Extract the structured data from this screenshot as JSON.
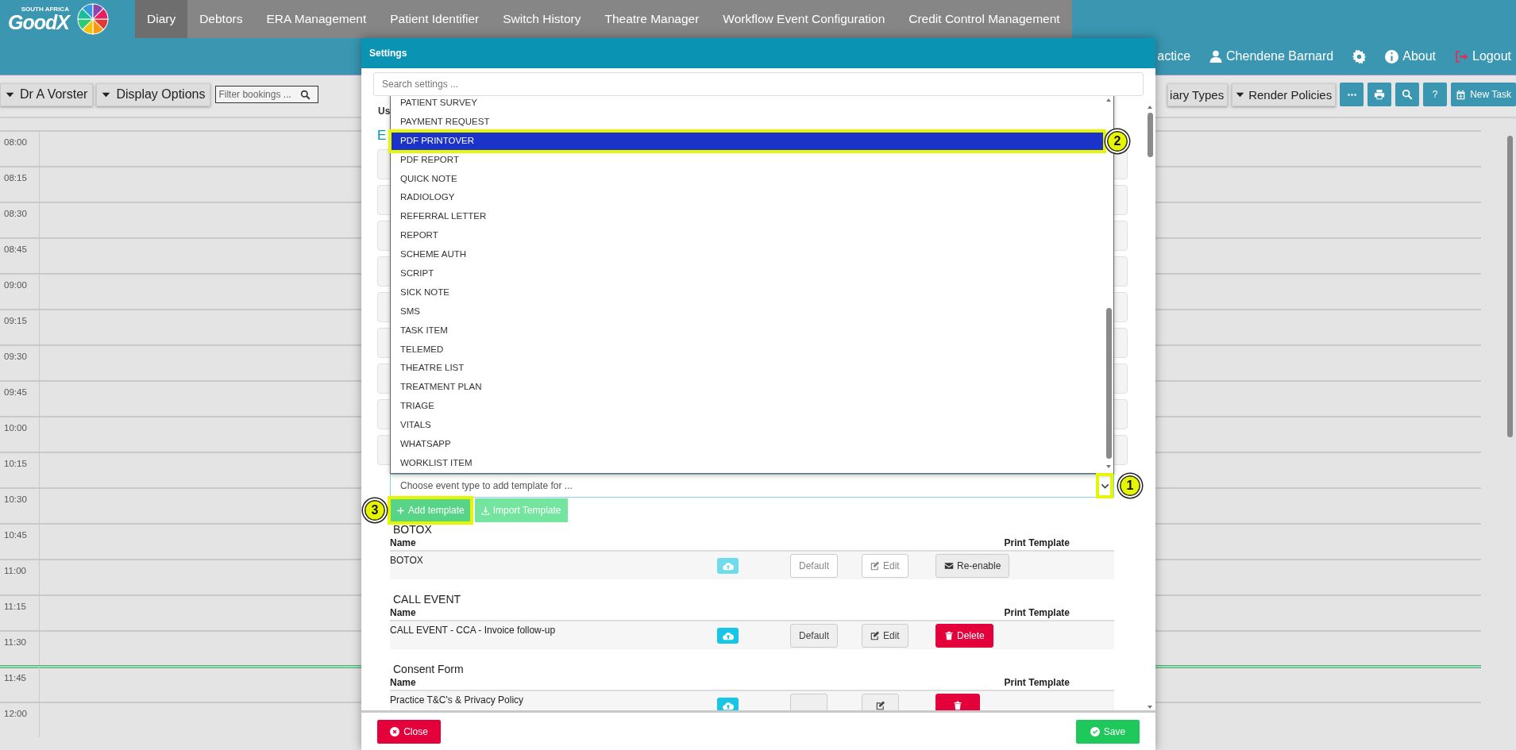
{
  "nav": {
    "logo": {
      "tagline": "SOUTH AFRICA",
      "wordmark": "GoodX"
    },
    "items": [
      {
        "label": "Diary",
        "selected": true
      },
      {
        "label": "Debtors",
        "selected": false
      },
      {
        "label": "ERA Management",
        "selected": false
      },
      {
        "label": "Patient Identifier",
        "selected": false
      },
      {
        "label": "Switch History",
        "selected": false
      },
      {
        "label": "Theatre Manager",
        "selected": false
      },
      {
        "label": "Workflow Event Configuration",
        "selected": false
      },
      {
        "label": "Credit Control Management",
        "selected": false
      }
    ]
  },
  "header": {
    "practice": "actice",
    "user": "Chendene Barnard",
    "about": "About",
    "logout": "Logout"
  },
  "toolbar": {
    "dropdowns_left": [
      "Dr A Vorster",
      "Display Options"
    ],
    "filter": {
      "placeholder": "Filter bookings ..."
    },
    "dropdowns_right": [
      {
        "label": "iary Types",
        "caret": false
      },
      {
        "label": "Render Policies",
        "caret": true
      }
    ],
    "help": "?",
    "new_task": "New Task"
  },
  "diary": {
    "slots": [
      {
        "time": "08:00",
        "now": false
      },
      {
        "time": "08:15",
        "now": false
      },
      {
        "time": "08:30",
        "now": false
      },
      {
        "time": "08:45",
        "now": false
      },
      {
        "time": "09:00",
        "now": false
      },
      {
        "time": "09:15",
        "now": false
      },
      {
        "time": "09:30",
        "now": false
      },
      {
        "time": "09:45",
        "now": false
      },
      {
        "time": "10:00",
        "now": false
      },
      {
        "time": "10:15",
        "now": false
      },
      {
        "time": "10:30",
        "now": false
      },
      {
        "time": "10:45",
        "now": false
      },
      {
        "time": "11:00",
        "now": false
      },
      {
        "time": "11:15",
        "now": false
      },
      {
        "time": "11:30",
        "now": true
      },
      {
        "time": "11:45",
        "now": false
      },
      {
        "time": "12:00",
        "now": false
      }
    ]
  },
  "settings": {
    "title": "Settings",
    "search": {
      "placeholder": "Search settings ..."
    },
    "behind": {
      "column_label": "Us",
      "heading": "E"
    },
    "event_type": {
      "placeholder": "Choose event type to add template for ...",
      "options": [
        {
          "label": "PATIENT SURVEY",
          "selected": false
        },
        {
          "label": "PAYMENT REQUEST",
          "selected": false
        },
        {
          "label": "PDF PRINTOVER",
          "selected": true
        },
        {
          "label": "PDF REPORT",
          "selected": false
        },
        {
          "label": "QUICK NOTE",
          "selected": false
        },
        {
          "label": "RADIOLOGY",
          "selected": false
        },
        {
          "label": "REFERRAL LETTER",
          "selected": false
        },
        {
          "label": "REPORT",
          "selected": false
        },
        {
          "label": "SCHEME AUTH",
          "selected": false
        },
        {
          "label": "SCRIPT",
          "selected": false
        },
        {
          "label": "SICK NOTE",
          "selected": false
        },
        {
          "label": "SMS",
          "selected": false
        },
        {
          "label": "TASK ITEM",
          "selected": false
        },
        {
          "label": "TELEMED",
          "selected": false
        },
        {
          "label": "THEATRE LIST",
          "selected": false
        },
        {
          "label": "TREATMENT PLAN",
          "selected": false
        },
        {
          "label": "TRIAGE",
          "selected": false
        },
        {
          "label": "VITALS",
          "selected": false
        },
        {
          "label": "WHATSAPP",
          "selected": false
        },
        {
          "label": "WORKLIST ITEM",
          "selected": false
        }
      ]
    },
    "actions": [
      {
        "label": "Add template",
        "kind": "add"
      },
      {
        "label": "Import Template",
        "kind": "import"
      }
    ],
    "sections": [
      {
        "title": "BOTOX",
        "columns": [
          "Name",
          "Print Template"
        ],
        "rows": [
          {
            "name": "BOTOX",
            "disabled": true,
            "buttons": [
              {
                "kind": "default",
                "label": "Default"
              },
              {
                "kind": "edit",
                "label": "Edit"
              },
              {
                "kind": "reenable",
                "label": "Re-enable"
              }
            ]
          }
        ]
      },
      {
        "title": "CALL EVENT",
        "columns": [
          "Name",
          "Print Template"
        ],
        "rows": [
          {
            "name": "CALL EVENT - CCA - Invoice follow-up",
            "disabled": false,
            "buttons": [
              {
                "kind": "default",
                "label": "Default"
              },
              {
                "kind": "edit",
                "label": "Edit"
              },
              {
                "kind": "delete",
                "label": "Delete"
              }
            ]
          }
        ]
      },
      {
        "title": "Consent Form",
        "columns": [
          "Name",
          "Print Template"
        ],
        "rows": [
          {
            "name": "Practice T&C's & Privacy Policy",
            "disabled": false,
            "buttons": [
              {
                "kind": "default"
              },
              {
                "kind": "edit"
              },
              {
                "kind": "delete"
              }
            ]
          }
        ]
      }
    ],
    "close": "Close",
    "save": "Save"
  },
  "annotations": [
    {
      "label": "1",
      "kind": "toggle"
    },
    {
      "label": "2",
      "kind": "option"
    },
    {
      "label": "3",
      "kind": "button"
    }
  ]
}
